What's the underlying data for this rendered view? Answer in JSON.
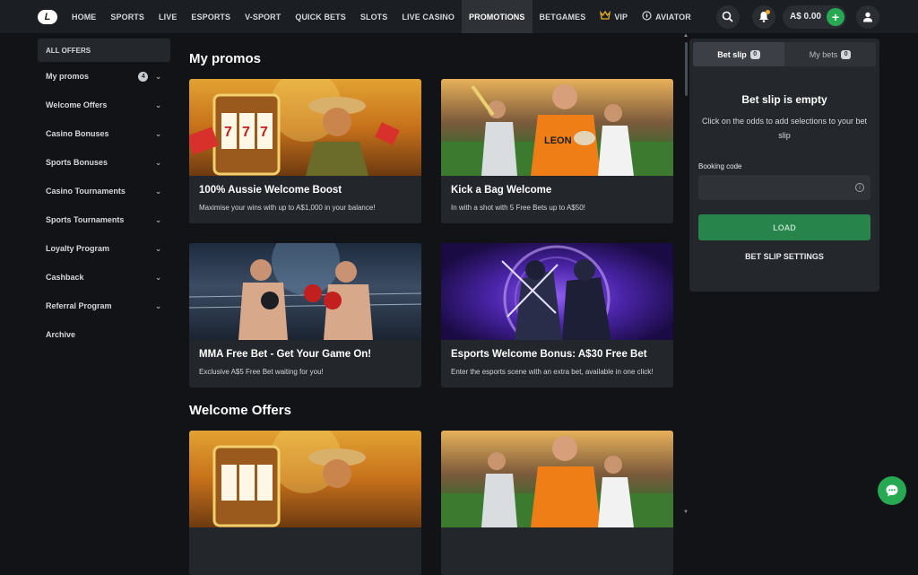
{
  "nav": {
    "logo_letter": "L",
    "items": [
      {
        "label": "HOME"
      },
      {
        "label": "SPORTS"
      },
      {
        "label": "LIVE"
      },
      {
        "label": "ESPORTS"
      },
      {
        "label": "V-SPORT"
      },
      {
        "label": "QUICK BETS"
      },
      {
        "label": "SLOTS"
      },
      {
        "label": "LIVE CASINO"
      },
      {
        "label": "PROMOTIONS"
      },
      {
        "label": "BETGAMES"
      },
      {
        "label": "VIP"
      },
      {
        "label": "AVIATOR"
      }
    ],
    "active": "PROMOTIONS",
    "balance": "A$ 0.00",
    "plus": "+"
  },
  "sidebar": {
    "header": "ALL OFFERS",
    "items": [
      {
        "label": "My promos",
        "badge": "4"
      },
      {
        "label": "Welcome Offers"
      },
      {
        "label": "Casino Bonuses"
      },
      {
        "label": "Sports Bonuses"
      },
      {
        "label": "Casino Tournaments"
      },
      {
        "label": "Sports Tournaments"
      },
      {
        "label": "Loyalty Program"
      },
      {
        "label": "Cashback"
      },
      {
        "label": "Referral Program"
      },
      {
        "label": "Archive"
      }
    ]
  },
  "main": {
    "section1_title": "My promos",
    "cards": [
      {
        "title": "100% Aussie Welcome Boost",
        "desc": "Maximise your wins with up to A$1,000 in your balance!"
      },
      {
        "title": "Kick a Bag Welcome",
        "desc": "In with a shot with 5 Free Bets up to A$50!"
      },
      {
        "title": "MMA Free Bet - Get Your Game On!",
        "desc": "Exclusive A$5 Free Bet waiting for you!"
      },
      {
        "title": "Esports Welcome Bonus: A$30 Free Bet",
        "desc": "Enter the esports scene with an extra bet, available in one click!"
      }
    ],
    "section2_title": "Welcome Offers"
  },
  "betslip": {
    "tab_active": "Bet slip",
    "tab_active_count": "0",
    "tab_other": "My bets",
    "tab_other_count": "0",
    "empty_title": "Bet slip is empty",
    "empty_desc": "Click on the odds to add selections to your bet slip",
    "booking_label": "Booking code",
    "booking_value": "",
    "load_label": "LOAD",
    "settings_label": "BET SLIP SETTINGS"
  },
  "colors": {
    "accent_green": "#27a853",
    "background": "#111317",
    "panel": "#24272c"
  }
}
